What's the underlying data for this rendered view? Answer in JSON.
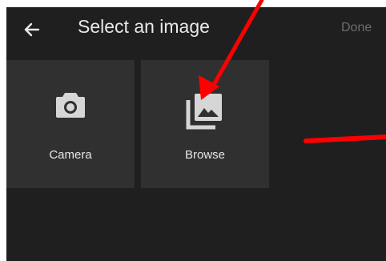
{
  "header": {
    "back_icon": "arrow-left-icon",
    "title": "Select an image",
    "done_label": "Done"
  },
  "tiles": [
    {
      "icon": "camera-icon",
      "label": "Camera"
    },
    {
      "icon": "photo-library-icon",
      "label": "Browse"
    }
  ],
  "annotations": {
    "color": "#ff0000"
  },
  "colors": {
    "background": "#1f1f1f",
    "tile": "#303030",
    "text": "#e8e8e8",
    "muted": "#6e6e6e"
  }
}
